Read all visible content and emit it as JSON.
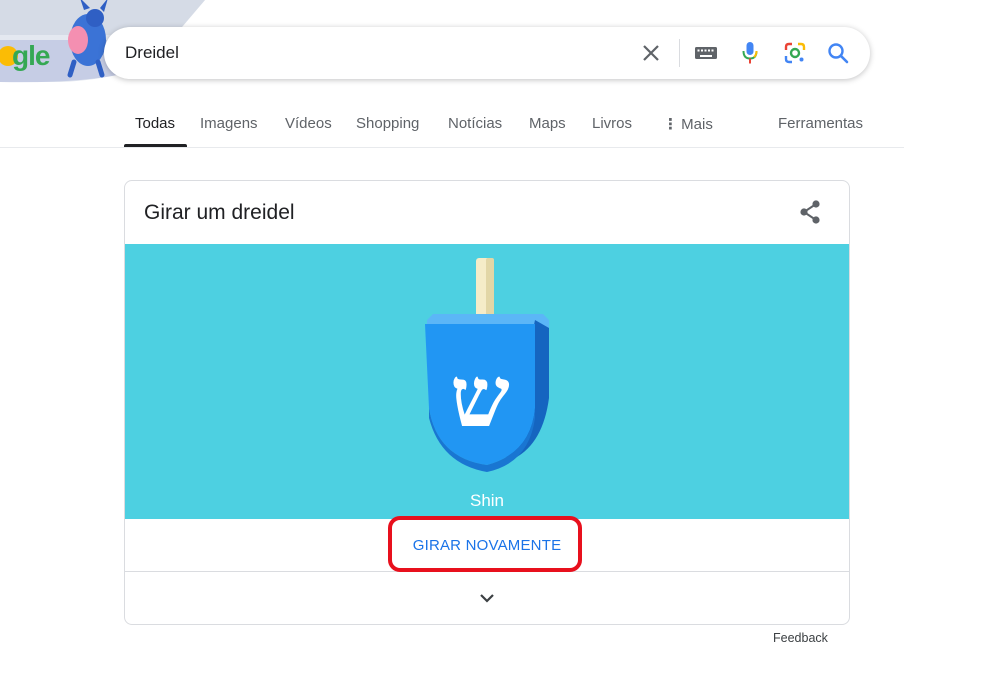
{
  "logo": {
    "text": "gle"
  },
  "search": {
    "query": "Dreidel",
    "icons": [
      "close-icon",
      "keyboard-icon",
      "microphone-icon",
      "lens-icon",
      "search-icon"
    ]
  },
  "tabs": [
    {
      "label": "Todas",
      "active": true
    },
    {
      "label": "Imagens"
    },
    {
      "label": "Vídeos"
    },
    {
      "label": "Shopping"
    },
    {
      "label": "Notícias"
    },
    {
      "label": "Maps"
    },
    {
      "label": "Livros"
    },
    {
      "label": "Mais",
      "icon": "more-vert-icon"
    }
  ],
  "tools": {
    "label": "Ferramentas"
  },
  "card": {
    "title": "Girar um dreidel",
    "result": "Shin",
    "letter": "ש",
    "spin_again": "GIRAR NOVAMENTE",
    "stage_color": "#4dd0e1",
    "dreidel_color": "#2196f3"
  },
  "feedback": "Feedback",
  "colors": {
    "link": "#1a73e8",
    "highlight": "#e8101d"
  }
}
